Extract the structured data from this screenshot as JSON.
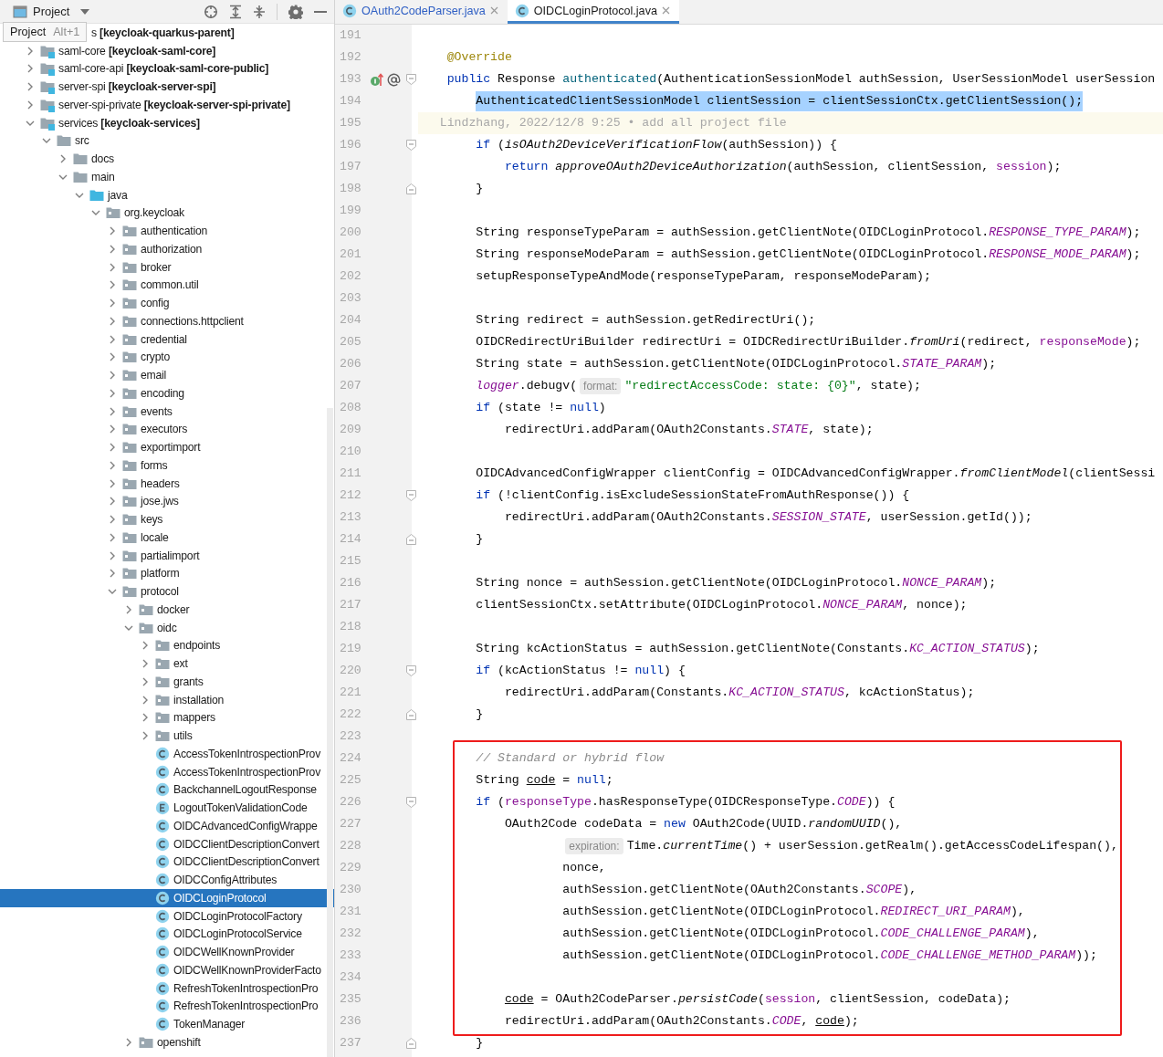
{
  "project_panel": {
    "title": "Project",
    "tooltip": {
      "label": "Project",
      "shortcut": "Alt+1"
    },
    "tree": [
      {
        "label": "s **[keycloak-quarkus-parent]**",
        "kind": "partial",
        "selected": false
      },
      {
        "label": "saml-core **[keycloak-saml-core]**",
        "kind": "module",
        "expanded": false,
        "selected": false
      },
      {
        "label": "saml-core-api **[keycloak-saml-core-public]**",
        "kind": "module",
        "expanded": false,
        "selected": false
      },
      {
        "label": "server-spi **[keycloak-server-spi]**",
        "kind": "module",
        "expanded": false,
        "selected": false
      },
      {
        "label": "server-spi-private **[keycloak-server-spi-private]**",
        "kind": "module",
        "expanded": false,
        "selected": false
      },
      {
        "label": "services **[keycloak-services]**",
        "kind": "module",
        "expanded": true,
        "selected": false,
        "children": [
          {
            "label": "src",
            "kind": "folder",
            "expanded": true,
            "selected": false,
            "children": [
              {
                "label": "docs",
                "kind": "folder",
                "expanded": false,
                "selected": false
              },
              {
                "label": "main",
                "kind": "folder",
                "expanded": true,
                "selected": false,
                "children": [
                  {
                    "label": "java",
                    "kind": "source-root",
                    "expanded": true,
                    "selected": false,
                    "children": [
                      {
                        "label": "org.keycloak",
                        "kind": "package",
                        "expanded": true,
                        "selected": false,
                        "children": [
                          {
                            "label": "authentication",
                            "kind": "package",
                            "expanded": false,
                            "selected": false
                          },
                          {
                            "label": "authorization",
                            "kind": "package",
                            "expanded": false,
                            "selected": false
                          },
                          {
                            "label": "broker",
                            "kind": "package",
                            "expanded": false,
                            "selected": false
                          },
                          {
                            "label": "common.util",
                            "kind": "package",
                            "expanded": false,
                            "selected": false
                          },
                          {
                            "label": "config",
                            "kind": "package",
                            "expanded": false,
                            "selected": false
                          },
                          {
                            "label": "connections.httpclient",
                            "kind": "package",
                            "expanded": false,
                            "selected": false
                          },
                          {
                            "label": "credential",
                            "kind": "package",
                            "expanded": false,
                            "selected": false
                          },
                          {
                            "label": "crypto",
                            "kind": "package",
                            "expanded": false,
                            "selected": false
                          },
                          {
                            "label": "email",
                            "kind": "package",
                            "expanded": false,
                            "selected": false
                          },
                          {
                            "label": "encoding",
                            "kind": "package",
                            "expanded": false,
                            "selected": false
                          },
                          {
                            "label": "events",
                            "kind": "package",
                            "expanded": false,
                            "selected": false
                          },
                          {
                            "label": "executors",
                            "kind": "package",
                            "expanded": false,
                            "selected": false
                          },
                          {
                            "label": "exportimport",
                            "kind": "package",
                            "expanded": false,
                            "selected": false
                          },
                          {
                            "label": "forms",
                            "kind": "package",
                            "expanded": false,
                            "selected": false
                          },
                          {
                            "label": "headers",
                            "kind": "package",
                            "expanded": false,
                            "selected": false
                          },
                          {
                            "label": "jose.jws",
                            "kind": "package",
                            "expanded": false,
                            "selected": false
                          },
                          {
                            "label": "keys",
                            "kind": "package",
                            "expanded": false,
                            "selected": false
                          },
                          {
                            "label": "locale",
                            "kind": "package",
                            "expanded": false,
                            "selected": false
                          },
                          {
                            "label": "partialimport",
                            "kind": "package",
                            "expanded": false,
                            "selected": false
                          },
                          {
                            "label": "platform",
                            "kind": "package",
                            "expanded": false,
                            "selected": false
                          },
                          {
                            "label": "protocol",
                            "kind": "package",
                            "expanded": true,
                            "selected": false,
                            "children": [
                              {
                                "label": "docker",
                                "kind": "package",
                                "expanded": false,
                                "selected": false
                              },
                              {
                                "label": "oidc",
                                "kind": "package",
                                "expanded": true,
                                "selected": false,
                                "children": [
                                  {
                                    "label": "endpoints",
                                    "kind": "package",
                                    "expanded": false,
                                    "selected": false
                                  },
                                  {
                                    "label": "ext",
                                    "kind": "package",
                                    "expanded": false,
                                    "selected": false
                                  },
                                  {
                                    "label": "grants",
                                    "kind": "package",
                                    "expanded": false,
                                    "selected": false
                                  },
                                  {
                                    "label": "installation",
                                    "kind": "package",
                                    "expanded": false,
                                    "selected": false
                                  },
                                  {
                                    "label": "mappers",
                                    "kind": "package",
                                    "expanded": false,
                                    "selected": false
                                  },
                                  {
                                    "label": "utils",
                                    "kind": "package",
                                    "expanded": false,
                                    "selected": false
                                  },
                                  {
                                    "label": "AccessTokenIntrospectionProv",
                                    "kind": "class",
                                    "selected": false
                                  },
                                  {
                                    "label": "AccessTokenIntrospectionProv",
                                    "kind": "class",
                                    "selected": false
                                  },
                                  {
                                    "label": "BackchannelLogoutResponse",
                                    "kind": "class",
                                    "selected": false
                                  },
                                  {
                                    "label": "LogoutTokenValidationCode",
                                    "kind": "enum",
                                    "selected": false
                                  },
                                  {
                                    "label": "OIDCAdvancedConfigWrappe",
                                    "kind": "class",
                                    "selected": false
                                  },
                                  {
                                    "label": "OIDCClientDescriptionConvert",
                                    "kind": "class",
                                    "selected": false
                                  },
                                  {
                                    "label": "OIDCClientDescriptionConvert",
                                    "kind": "class",
                                    "selected": false
                                  },
                                  {
                                    "label": "OIDCConfigAttributes",
                                    "kind": "class",
                                    "selected": false
                                  },
                                  {
                                    "label": "OIDCLoginProtocol",
                                    "kind": "class",
                                    "selected": true
                                  },
                                  {
                                    "label": "OIDCLoginProtocolFactory",
                                    "kind": "class",
                                    "selected": false
                                  },
                                  {
                                    "label": "OIDCLoginProtocolService",
                                    "kind": "class",
                                    "selected": false
                                  },
                                  {
                                    "label": "OIDCWellKnownProvider",
                                    "kind": "class",
                                    "selected": false
                                  },
                                  {
                                    "label": "OIDCWellKnownProviderFacto",
                                    "kind": "class",
                                    "selected": false
                                  },
                                  {
                                    "label": "RefreshTokenIntrospectionPro",
                                    "kind": "class",
                                    "selected": false
                                  },
                                  {
                                    "label": "RefreshTokenIntrospectionPro",
                                    "kind": "class",
                                    "selected": false
                                  },
                                  {
                                    "label": "TokenManager",
                                    "kind": "class",
                                    "selected": false
                                  }
                                ]
                              },
                              {
                                "label": "openshift",
                                "kind": "package",
                                "expanded": false,
                                "selected": false
                              }
                            ]
                          }
                        ]
                      }
                    ]
                  }
                ]
              }
            ]
          }
        ]
      }
    ]
  },
  "editor": {
    "tabs": [
      {
        "label": "OAuth2CodeParser.java",
        "selected": false,
        "vcs_modified": true
      },
      {
        "label": "OIDCLoginProtocol.java",
        "selected": true,
        "vcs_modified": false
      }
    ],
    "lines": [
      {
        "number": "191",
        "kind": "code",
        "boxed": false
      },
      {
        "number": "192",
        "kind": "code",
        "boxed": false,
        "tokens": [
          {
            "text": "    @Override",
            "kind": "annotation"
          }
        ]
      },
      {
        "number": "193",
        "kind": "code",
        "boxed": false,
        "markers": [
          {
            "kind": "override"
          },
          {
            "kind": "at"
          },
          {
            "kind": "fold-start"
          }
        ],
        "tokens": [
          {
            "text": "    public",
            "kind": "keyword"
          },
          {
            "text": " Response ",
            "kind": "plain"
          },
          {
            "text": "authenticated",
            "kind": "decl"
          },
          {
            "text": "(AuthenticationSessionModel authSession, UserSessionModel userSession",
            "kind": "plain"
          }
        ]
      },
      {
        "number": "194",
        "kind": "selected",
        "boxed": false,
        "tokens": [
          {
            "text": "        AuthenticatedClientSessionModel clientSession = clientSessionCtx.getClientSession();",
            "kind": "plain"
          }
        ]
      },
      {
        "number": "195",
        "kind": "blame",
        "boxed": false,
        "tokens": [
          {
            "text": "   Lindzhang, 2022/12/8 9:25 • add all project file",
            "kind": "blame"
          }
        ]
      },
      {
        "number": "196",
        "kind": "code",
        "boxed": false,
        "markers": [
          {
            "kind": "fold-start"
          }
        ],
        "tokens": [
          {
            "text": "        if",
            "kind": "keyword"
          },
          {
            "text": " (",
            "kind": "plain"
          },
          {
            "text": "isOAuth2DeviceVerificationFlow",
            "kind": "static"
          },
          {
            "text": "(authSession)) {",
            "kind": "plain"
          }
        ]
      },
      {
        "number": "197",
        "kind": "code",
        "boxed": false,
        "tokens": [
          {
            "text": "            return ",
            "kind": "keyword"
          },
          {
            "text": "approveOAuth2DeviceAuthorization",
            "kind": "static"
          },
          {
            "text": "(authSession, clientSession, ",
            "kind": "plain"
          },
          {
            "text": "session",
            "kind": "var"
          },
          {
            "text": ");",
            "kind": "plain"
          }
        ]
      },
      {
        "number": "198",
        "kind": "code",
        "boxed": false,
        "markers": [
          {
            "kind": "fold-end"
          }
        ],
        "tokens": [
          {
            "text": "        }",
            "kind": "plain"
          }
        ]
      },
      {
        "number": "199",
        "kind": "code",
        "boxed": false
      },
      {
        "number": "200",
        "kind": "code",
        "boxed": false,
        "tokens": [
          {
            "text": "        String responseTypeParam = authSession.getClientNote(OIDCLoginProtocol.",
            "kind": "plain"
          },
          {
            "text": "RESPONSE_TYPE_PARAM",
            "kind": "field"
          },
          {
            "text": ");",
            "kind": "plain"
          }
        ]
      },
      {
        "number": "201",
        "kind": "code",
        "boxed": false,
        "tokens": [
          {
            "text": "        String responseModeParam = authSession.getClientNote(OIDCLoginProtocol.",
            "kind": "plain"
          },
          {
            "text": "RESPONSE_MODE_PARAM",
            "kind": "field"
          },
          {
            "text": ");",
            "kind": "plain"
          }
        ]
      },
      {
        "number": "202",
        "kind": "code",
        "boxed": false,
        "tokens": [
          {
            "text": "        setupResponseTypeAndMode(responseTypeParam, responseModeParam);",
            "kind": "plain"
          }
        ]
      },
      {
        "number": "203",
        "kind": "code",
        "boxed": false
      },
      {
        "number": "204",
        "kind": "code",
        "boxed": false,
        "tokens": [
          {
            "text": "        String redirect = authSession.getRedirectUri();",
            "kind": "plain"
          }
        ]
      },
      {
        "number": "205",
        "kind": "code",
        "boxed": false,
        "tokens": [
          {
            "text": "        OIDCRedirectUriBuilder redirectUri = OIDCRedirectUriBuilder.",
            "kind": "plain"
          },
          {
            "text": "fromUri",
            "kind": "static"
          },
          {
            "text": "(redirect, ",
            "kind": "plain"
          },
          {
            "text": "responseMode",
            "kind": "var"
          },
          {
            "text": ");",
            "kind": "plain"
          }
        ]
      },
      {
        "number": "206",
        "kind": "code",
        "boxed": false,
        "tokens": [
          {
            "text": "        String state = authSession.getClientNote(OIDCLoginProtocol.",
            "kind": "plain"
          },
          {
            "text": "STATE_PARAM",
            "kind": "field"
          },
          {
            "text": ");",
            "kind": "plain"
          }
        ]
      },
      {
        "number": "207",
        "kind": "code",
        "boxed": false,
        "tokens": [
          {
            "text": "        logger",
            "kind": "field"
          },
          {
            "text": ".debugv(",
            "kind": "plain"
          },
          {
            "text": "format:",
            "kind": "hint"
          },
          {
            "text": "\"redirectAccessCode: state: {0}\"",
            "kind": "string"
          },
          {
            "text": ", state);",
            "kind": "plain"
          }
        ]
      },
      {
        "number": "208",
        "kind": "code",
        "boxed": false,
        "tokens": [
          {
            "text": "        if",
            "kind": "keyword"
          },
          {
            "text": " (state != ",
            "kind": "plain"
          },
          {
            "text": "null",
            "kind": "keyword"
          },
          {
            "text": ")",
            "kind": "plain"
          }
        ]
      },
      {
        "number": "209",
        "kind": "code",
        "boxed": false,
        "tokens": [
          {
            "text": "            redirectUri.addParam(OAuth2Constants.",
            "kind": "plain"
          },
          {
            "text": "STATE",
            "kind": "field"
          },
          {
            "text": ", state);",
            "kind": "plain"
          }
        ]
      },
      {
        "number": "210",
        "kind": "code",
        "boxed": false
      },
      {
        "number": "211",
        "kind": "code",
        "boxed": false,
        "tokens": [
          {
            "text": "        OIDCAdvancedConfigWrapper clientConfig = OIDCAdvancedConfigWrapper.",
            "kind": "plain"
          },
          {
            "text": "fromClientModel",
            "kind": "static"
          },
          {
            "text": "(clientSessi",
            "kind": "plain"
          }
        ]
      },
      {
        "number": "212",
        "kind": "code",
        "boxed": false,
        "markers": [
          {
            "kind": "fold-start"
          }
        ],
        "tokens": [
          {
            "text": "        if",
            "kind": "keyword"
          },
          {
            "text": " (!clientConfig.isExcludeSessionStateFromAuthResponse()) {",
            "kind": "plain"
          }
        ]
      },
      {
        "number": "213",
        "kind": "code",
        "boxed": false,
        "tokens": [
          {
            "text": "            redirectUri.addParam(OAuth2Constants.",
            "kind": "plain"
          },
          {
            "text": "SESSION_STATE",
            "kind": "field"
          },
          {
            "text": ", userSession.getId());",
            "kind": "plain"
          }
        ]
      },
      {
        "number": "214",
        "kind": "code",
        "boxed": false,
        "markers": [
          {
            "kind": "fold-end"
          }
        ],
        "tokens": [
          {
            "text": "        }",
            "kind": "plain"
          }
        ]
      },
      {
        "number": "215",
        "kind": "code",
        "boxed": false
      },
      {
        "number": "216",
        "kind": "code",
        "boxed": false,
        "tokens": [
          {
            "text": "        String nonce = authSession.getClientNote(OIDCLoginProtocol.",
            "kind": "plain"
          },
          {
            "text": "NONCE_PARAM",
            "kind": "field"
          },
          {
            "text": ");",
            "kind": "plain"
          }
        ]
      },
      {
        "number": "217",
        "kind": "code",
        "boxed": false,
        "tokens": [
          {
            "text": "        clientSessionCtx.setAttribute(OIDCLoginProtocol.",
            "kind": "plain"
          },
          {
            "text": "NONCE_PARAM",
            "kind": "field"
          },
          {
            "text": ", nonce);",
            "kind": "plain"
          }
        ]
      },
      {
        "number": "218",
        "kind": "code",
        "boxed": false
      },
      {
        "number": "219",
        "kind": "code",
        "boxed": false,
        "tokens": [
          {
            "text": "        String kcActionStatus = authSession.getClientNote(Constants.",
            "kind": "plain"
          },
          {
            "text": "KC_ACTION_STATUS",
            "kind": "field"
          },
          {
            "text": ");",
            "kind": "plain"
          }
        ]
      },
      {
        "number": "220",
        "kind": "code",
        "boxed": false,
        "markers": [
          {
            "kind": "fold-start"
          }
        ],
        "tokens": [
          {
            "text": "        if",
            "kind": "keyword"
          },
          {
            "text": " (kcActionStatus != ",
            "kind": "plain"
          },
          {
            "text": "null",
            "kind": "keyword"
          },
          {
            "text": ") {",
            "kind": "plain"
          }
        ]
      },
      {
        "number": "221",
        "kind": "code",
        "boxed": false,
        "tokens": [
          {
            "text": "            redirectUri.addParam(Constants.",
            "kind": "plain"
          },
          {
            "text": "KC_ACTION_STATUS",
            "kind": "field"
          },
          {
            "text": ", kcActionStatus);",
            "kind": "plain"
          }
        ]
      },
      {
        "number": "222",
        "kind": "code",
        "boxed": false,
        "markers": [
          {
            "kind": "fold-end"
          }
        ],
        "tokens": [
          {
            "text": "        }",
            "kind": "plain"
          }
        ]
      },
      {
        "number": "223",
        "kind": "code",
        "boxed": false
      },
      {
        "number": "224",
        "kind": "code",
        "boxed": true,
        "tokens": [
          {
            "text": "        // Standard or hybrid flow",
            "kind": "comment"
          }
        ]
      },
      {
        "number": "225",
        "kind": "code",
        "boxed": true,
        "tokens": [
          {
            "text": "        String ",
            "kind": "plain"
          },
          {
            "text": "code",
            "kind": "underlined"
          },
          {
            "text": " = ",
            "kind": "plain"
          },
          {
            "text": "null",
            "kind": "keyword"
          },
          {
            "text": ";",
            "kind": "plain"
          }
        ]
      },
      {
        "number": "226",
        "kind": "code",
        "boxed": true,
        "markers": [
          {
            "kind": "fold-start"
          }
        ],
        "tokens": [
          {
            "text": "        if",
            "kind": "keyword"
          },
          {
            "text": " (",
            "kind": "plain"
          },
          {
            "text": "responseType",
            "kind": "var"
          },
          {
            "text": ".hasResponseType(OIDCResponseType.",
            "kind": "plain"
          },
          {
            "text": "CODE",
            "kind": "field"
          },
          {
            "text": ")) {",
            "kind": "plain"
          }
        ]
      },
      {
        "number": "227",
        "kind": "code",
        "boxed": true,
        "tokens": [
          {
            "text": "            OAuth2Code codeData = ",
            "kind": "plain"
          },
          {
            "text": "new",
            "kind": "keyword"
          },
          {
            "text": " OAuth2Code(UUID.",
            "kind": "plain"
          },
          {
            "text": "randomUUID",
            "kind": "static"
          },
          {
            "text": "(),",
            "kind": "plain"
          }
        ]
      },
      {
        "number": "228",
        "kind": "code",
        "boxed": true,
        "tokens": [
          {
            "text": "                    expiration:",
            "kind": "hint"
          },
          {
            "text": "Time.",
            "kind": "plain"
          },
          {
            "text": "currentTime",
            "kind": "static"
          },
          {
            "text": "() + userSession.getRealm().getAccessCodeLifespan(),",
            "kind": "plain"
          }
        ]
      },
      {
        "number": "229",
        "kind": "code",
        "boxed": true,
        "tokens": [
          {
            "text": "                    nonce,",
            "kind": "plain"
          }
        ]
      },
      {
        "number": "230",
        "kind": "code",
        "boxed": true,
        "tokens": [
          {
            "text": "                    authSession.getClientNote(OAuth2Constants.",
            "kind": "plain"
          },
          {
            "text": "SCOPE",
            "kind": "field"
          },
          {
            "text": "),",
            "kind": "plain"
          }
        ]
      },
      {
        "number": "231",
        "kind": "code",
        "boxed": true,
        "tokens": [
          {
            "text": "                    authSession.getClientNote(OIDCLoginProtocol.",
            "kind": "plain"
          },
          {
            "text": "REDIRECT_URI_PARAM",
            "kind": "field"
          },
          {
            "text": "),",
            "kind": "plain"
          }
        ]
      },
      {
        "number": "232",
        "kind": "code",
        "boxed": true,
        "tokens": [
          {
            "text": "                    authSession.getClientNote(OIDCLoginProtocol.",
            "kind": "plain"
          },
          {
            "text": "CODE_CHALLENGE_PARAM",
            "kind": "field"
          },
          {
            "text": "),",
            "kind": "plain"
          }
        ]
      },
      {
        "number": "233",
        "kind": "code",
        "boxed": true,
        "tokens": [
          {
            "text": "                    authSession.getClientNote(OIDCLoginProtocol.",
            "kind": "plain"
          },
          {
            "text": "CODE_CHALLENGE_METHOD_PARAM",
            "kind": "field"
          },
          {
            "text": "));",
            "kind": "plain"
          }
        ]
      },
      {
        "number": "234",
        "kind": "code",
        "boxed": true
      },
      {
        "number": "235",
        "kind": "code",
        "boxed": true,
        "tokens": [
          {
            "text": "            code",
            "kind": "underlined"
          },
          {
            "text": " = OAuth2CodeParser.",
            "kind": "plain"
          },
          {
            "text": "persistCode",
            "kind": "static"
          },
          {
            "text": "(",
            "kind": "plain"
          },
          {
            "text": "session",
            "kind": "var"
          },
          {
            "text": ", clientSession, codeData);",
            "kind": "plain"
          }
        ]
      },
      {
        "number": "236",
        "kind": "code",
        "boxed": true,
        "tokens": [
          {
            "text": "            redirectUri.addParam(OAuth2Constants.",
            "kind": "plain"
          },
          {
            "text": "CODE",
            "kind": "field"
          },
          {
            "text": ", ",
            "kind": "plain"
          },
          {
            "text": "code",
            "kind": "underlined"
          },
          {
            "text": ");",
            "kind": "plain"
          }
        ]
      },
      {
        "number": "237",
        "kind": "code",
        "boxed": false,
        "markers": [
          {
            "kind": "fold-end"
          }
        ],
        "tokens": [
          {
            "text": "        }",
            "kind": "plain"
          }
        ]
      }
    ]
  }
}
